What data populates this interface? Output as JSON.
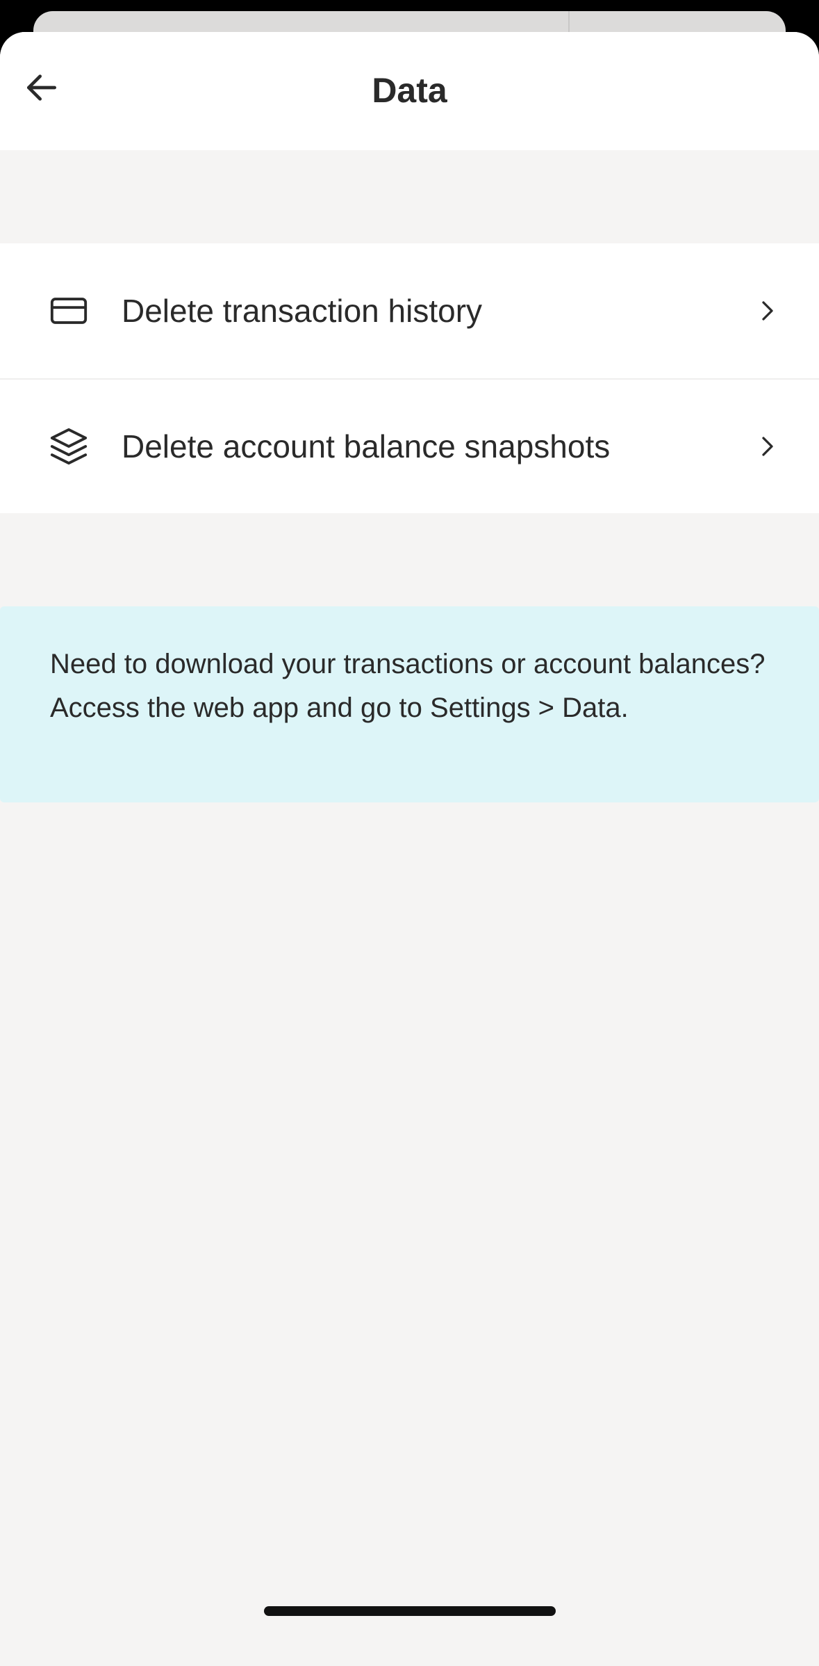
{
  "header": {
    "title": "Data",
    "back_icon": "arrow-left-icon"
  },
  "menu": {
    "items": [
      {
        "label": "Delete transaction history",
        "icon": "credit-card-icon"
      },
      {
        "label": "Delete account balance snapshots",
        "icon": "layers-icon"
      }
    ]
  },
  "info": {
    "text": "Need to download your transactions or account balances? Access the web app and go to Settings > Data."
  },
  "colors": {
    "sheet_background": "#f5f4f3",
    "card_background": "#ffffff",
    "info_background": "#ddf5f8",
    "text": "#2a2a2a"
  }
}
